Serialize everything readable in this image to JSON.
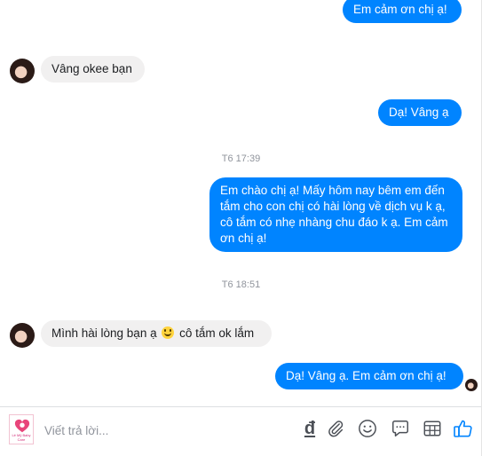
{
  "conversation": {
    "msg_top_out": "Em cảm ơn chị ạ!",
    "msg_in_1": "Vâng okee bạn",
    "msg_out_1": "Dạ! Vâng ạ",
    "time_1": "T6 17:39",
    "msg_out_2": "Em chào chị ạ! Mấy hôm nay bêm em đến tắm cho con chị có hài lòng về dịch vụ k ạ, cô tắm có nhẹ nhàng chu đáo k ạ. Em cảm ơn chị ạ!",
    "time_2": "T6 18:51",
    "msg_in_2_before": "Mình hài lòng bạn ạ",
    "msg_in_2_after": "cô tắm ok lắm",
    "msg_out_3": "Dạ! Vâng ạ. Em cảm ơn chị ạ!"
  },
  "composer": {
    "placeholder": "Viết trả lời...",
    "logo_text": "Lê Mỹ Baby Care",
    "currency_symbol": "đ"
  },
  "icons": [
    "currency-icon",
    "paperclip-icon",
    "emoji-icon",
    "sticker-icon",
    "gif-icon",
    "like-icon"
  ],
  "colors": {
    "outgoing": "#0084ff",
    "incoming": "#f1f0f0",
    "icon": "#4b4f56",
    "like": "#0084ff"
  }
}
